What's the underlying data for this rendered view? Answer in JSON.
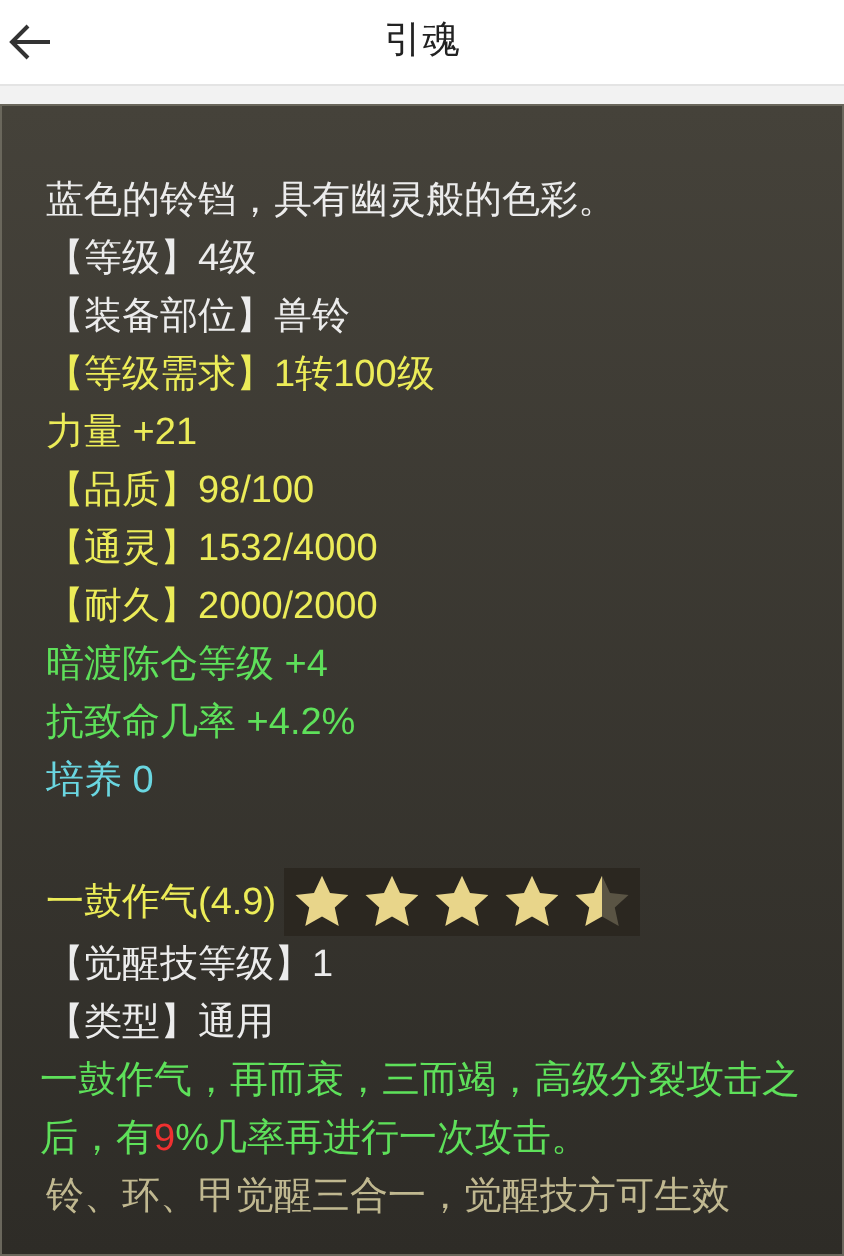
{
  "header": {
    "title": "引魂"
  },
  "lines": [
    {
      "kind": "line",
      "text": "蓝色的铃铛，具有幽灵般的色彩。",
      "color": "#ececec"
    },
    {
      "kind": "line",
      "text": "【等级】4级",
      "color": "#ececec"
    },
    {
      "kind": "line",
      "text": "【装备部位】兽铃",
      "color": "#ececec"
    },
    {
      "kind": "line",
      "text": "【等级需求】1转100级",
      "color": "#ecec58"
    },
    {
      "kind": "line",
      "text": "力量 +21",
      "color": "#ecec58"
    },
    {
      "kind": "line",
      "text": "【品质】98/100",
      "color": "#ecec58"
    },
    {
      "kind": "line",
      "text": "【通灵】1532/4000",
      "color": "#ecec58"
    },
    {
      "kind": "line",
      "text": "【耐久】2000/2000",
      "color": "#ecec58"
    },
    {
      "kind": "line",
      "text": "暗渡陈仓等级 +4",
      "color": "#5ee05a"
    },
    {
      "kind": "line",
      "text": "抗致命几率 +4.2%",
      "color": "#5ee05a"
    },
    {
      "kind": "line",
      "text": "培养 0",
      "color": "#6ad6e0"
    },
    {
      "kind": "gap"
    },
    {
      "kind": "rating",
      "text": "一鼓作气(4.9)",
      "color": "#ecec58",
      "stars": 4.5
    },
    {
      "kind": "line",
      "text": "【觉醒技等级】1",
      "color": "#ececec"
    },
    {
      "kind": "line",
      "text": "【类型】通用",
      "color": "#ececec"
    },
    {
      "kind": "paragraph",
      "segments": [
        {
          "text": "一鼓作气，再而衰，三而竭，高级分裂攻击之后，有",
          "color": "#5ee05a"
        },
        {
          "text": "9",
          "color": "#f03030"
        },
        {
          "text": "%几率再进行一次攻击。",
          "color": "#5ee05a"
        }
      ]
    },
    {
      "kind": "line",
      "text": "铃、环、甲觉醒三合一，觉醒技方可生效",
      "color": "#c0b890"
    }
  ]
}
